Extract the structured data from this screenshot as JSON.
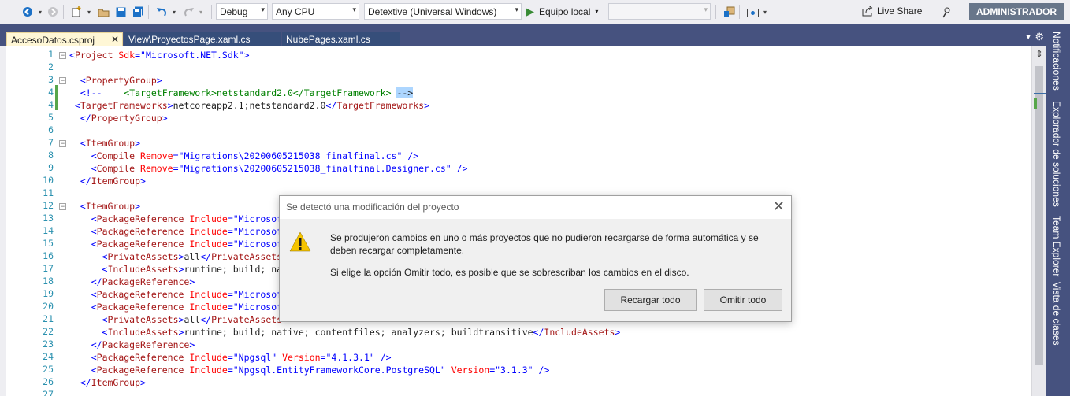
{
  "toolbar": {
    "configuration": "Debug",
    "platform": "Any CPU",
    "startup_project": "Detextive (Universal Windows)",
    "run_target": "Equipo local",
    "live_share": "Live Share",
    "user": "ADMINISTRADOR"
  },
  "tabs": [
    {
      "label": "AccesoDatos.csproj",
      "active": true
    },
    {
      "label": "View\\ProyectosPage.xaml.cs",
      "active": false
    },
    {
      "label": "NubePages.xaml.cs",
      "active": false
    }
  ],
  "side_panels": [
    "Notificaciones",
    "Explorador de soluciones",
    "Team Explorer",
    "Vista de clases"
  ],
  "code": {
    "line_numbers": [
      "1",
      "2",
      "3",
      "4",
      "4",
      "5",
      "6",
      "7",
      "8",
      "9",
      "10",
      "11",
      "12",
      "13",
      "14",
      "15",
      "16",
      "17",
      "18",
      "19",
      "20",
      "21",
      "22",
      "23",
      "24",
      "25",
      "26",
      "27",
      "28"
    ],
    "lines": [
      [
        {
          "c": "p",
          "t": "<"
        },
        {
          "c": "t",
          "t": "Project"
        },
        {
          "c": "a",
          "t": " Sdk"
        },
        {
          "c": "p",
          "t": "=\""
        },
        {
          "c": "v",
          "t": "Microsoft.NET.Sdk"
        },
        {
          "c": "p",
          "t": "\">"
        }
      ],
      [],
      [
        {
          "c": "k",
          "t": "  "
        },
        {
          "c": "p",
          "t": "<"
        },
        {
          "c": "t",
          "t": "PropertyGroup"
        },
        {
          "c": "p",
          "t": ">"
        }
      ],
      [
        {
          "c": "k",
          "t": "  "
        },
        {
          "c": "p",
          "t": "<!--"
        },
        {
          "c": "c",
          "t": "    <TargetFramework>netstandard2.0</TargetFramework> "
        },
        {
          "c": "sel",
          "t": "-->"
        }
      ],
      [
        {
          "c": "k",
          "t": " "
        },
        {
          "c": "p",
          "t": "<"
        },
        {
          "c": "t",
          "t": "TargetFrameworks"
        },
        {
          "c": "p",
          "t": ">"
        },
        {
          "c": "k",
          "t": "netcoreapp2.1;netstandard2.0"
        },
        {
          "c": "p",
          "t": "</"
        },
        {
          "c": "t",
          "t": "TargetFrameworks"
        },
        {
          "c": "p",
          "t": ">"
        }
      ],
      [
        {
          "c": "k",
          "t": "  "
        },
        {
          "c": "p",
          "t": "</"
        },
        {
          "c": "t",
          "t": "PropertyGroup"
        },
        {
          "c": "p",
          "t": ">"
        }
      ],
      [],
      [
        {
          "c": "k",
          "t": "  "
        },
        {
          "c": "p",
          "t": "<"
        },
        {
          "c": "t",
          "t": "ItemGroup"
        },
        {
          "c": "p",
          "t": ">"
        }
      ],
      [
        {
          "c": "k",
          "t": "    "
        },
        {
          "c": "p",
          "t": "<"
        },
        {
          "c": "t",
          "t": "Compile"
        },
        {
          "c": "a",
          "t": " Remove"
        },
        {
          "c": "p",
          "t": "=\""
        },
        {
          "c": "v",
          "t": "Migrations\\20200605215038_finalfinal.cs"
        },
        {
          "c": "p",
          "t": "\" />"
        }
      ],
      [
        {
          "c": "k",
          "t": "    "
        },
        {
          "c": "p",
          "t": "<"
        },
        {
          "c": "t",
          "t": "Compile"
        },
        {
          "c": "a",
          "t": " Remove"
        },
        {
          "c": "p",
          "t": "=\""
        },
        {
          "c": "v",
          "t": "Migrations\\20200605215038_finalfinal.Designer.cs"
        },
        {
          "c": "p",
          "t": "\" />"
        }
      ],
      [
        {
          "c": "k",
          "t": "  "
        },
        {
          "c": "p",
          "t": "</"
        },
        {
          "c": "t",
          "t": "ItemGroup"
        },
        {
          "c": "p",
          "t": ">"
        }
      ],
      [],
      [
        {
          "c": "k",
          "t": "  "
        },
        {
          "c": "p",
          "t": "<"
        },
        {
          "c": "t",
          "t": "ItemGroup"
        },
        {
          "c": "p",
          "t": ">"
        }
      ],
      [
        {
          "c": "k",
          "t": "    "
        },
        {
          "c": "p",
          "t": "<"
        },
        {
          "c": "t",
          "t": "PackageReference"
        },
        {
          "c": "a",
          "t": " Include"
        },
        {
          "c": "p",
          "t": "=\""
        },
        {
          "c": "v",
          "t": "Microsof"
        }
      ],
      [
        {
          "c": "k",
          "t": "    "
        },
        {
          "c": "p",
          "t": "<"
        },
        {
          "c": "t",
          "t": "PackageReference"
        },
        {
          "c": "a",
          "t": " Include"
        },
        {
          "c": "p",
          "t": "=\""
        },
        {
          "c": "v",
          "t": "Microsof"
        }
      ],
      [
        {
          "c": "k",
          "t": "    "
        },
        {
          "c": "p",
          "t": "<"
        },
        {
          "c": "t",
          "t": "PackageReference"
        },
        {
          "c": "a",
          "t": " Include"
        },
        {
          "c": "p",
          "t": "=\""
        },
        {
          "c": "v",
          "t": "Microsof"
        }
      ],
      [
        {
          "c": "k",
          "t": "      "
        },
        {
          "c": "p",
          "t": "<"
        },
        {
          "c": "t",
          "t": "PrivateAssets"
        },
        {
          "c": "p",
          "t": ">"
        },
        {
          "c": "k",
          "t": "all"
        },
        {
          "c": "p",
          "t": "</"
        },
        {
          "c": "t",
          "t": "PrivateAssets"
        }
      ],
      [
        {
          "c": "k",
          "t": "      "
        },
        {
          "c": "p",
          "t": "<"
        },
        {
          "c": "t",
          "t": "IncludeAssets"
        },
        {
          "c": "p",
          "t": ">"
        },
        {
          "c": "k",
          "t": "runtime; build; nat"
        }
      ],
      [
        {
          "c": "k",
          "t": "    "
        },
        {
          "c": "p",
          "t": "</"
        },
        {
          "c": "t",
          "t": "PackageReference"
        },
        {
          "c": "p",
          "t": ">"
        }
      ],
      [
        {
          "c": "k",
          "t": "    "
        },
        {
          "c": "p",
          "t": "<"
        },
        {
          "c": "t",
          "t": "PackageReference"
        },
        {
          "c": "a",
          "t": " Include"
        },
        {
          "c": "p",
          "t": "=\""
        },
        {
          "c": "v",
          "t": "Microsof"
        }
      ],
      [
        {
          "c": "k",
          "t": "    "
        },
        {
          "c": "p",
          "t": "<"
        },
        {
          "c": "t",
          "t": "PackageReference"
        },
        {
          "c": "a",
          "t": " Include"
        },
        {
          "c": "p",
          "t": "=\""
        },
        {
          "c": "v",
          "t": "Microsof"
        }
      ],
      [
        {
          "c": "k",
          "t": "      "
        },
        {
          "c": "p",
          "t": "<"
        },
        {
          "c": "t",
          "t": "PrivateAssets"
        },
        {
          "c": "p",
          "t": ">"
        },
        {
          "c": "k",
          "t": "all"
        },
        {
          "c": "p",
          "t": "</"
        },
        {
          "c": "t",
          "t": "PrivateAssets"
        }
      ],
      [
        {
          "c": "k",
          "t": "      "
        },
        {
          "c": "p",
          "t": "<"
        },
        {
          "c": "t",
          "t": "IncludeAssets"
        },
        {
          "c": "p",
          "t": ">"
        },
        {
          "c": "k",
          "t": "runtime; build; native; contentfiles; analyzers; buildtransitive"
        },
        {
          "c": "p",
          "t": "</"
        },
        {
          "c": "t",
          "t": "IncludeAssets"
        },
        {
          "c": "p",
          "t": ">"
        }
      ],
      [
        {
          "c": "k",
          "t": "    "
        },
        {
          "c": "p",
          "t": "</"
        },
        {
          "c": "t",
          "t": "PackageReference"
        },
        {
          "c": "p",
          "t": ">"
        }
      ],
      [
        {
          "c": "k",
          "t": "    "
        },
        {
          "c": "p",
          "t": "<"
        },
        {
          "c": "t",
          "t": "PackageReference"
        },
        {
          "c": "a",
          "t": " Include"
        },
        {
          "c": "p",
          "t": "=\""
        },
        {
          "c": "v",
          "t": "Npgsql"
        },
        {
          "c": "p",
          "t": "\""
        },
        {
          "c": "a",
          "t": " Version"
        },
        {
          "c": "p",
          "t": "=\""
        },
        {
          "c": "v",
          "t": "4.1.3.1"
        },
        {
          "c": "p",
          "t": "\" />"
        }
      ],
      [
        {
          "c": "k",
          "t": "    "
        },
        {
          "c": "p",
          "t": "<"
        },
        {
          "c": "t",
          "t": "PackageReference"
        },
        {
          "c": "a",
          "t": " Include"
        },
        {
          "c": "p",
          "t": "=\""
        },
        {
          "c": "v",
          "t": "Npgsql.EntityFrameworkCore.PostgreSQL"
        },
        {
          "c": "p",
          "t": "\""
        },
        {
          "c": "a",
          "t": " Version"
        },
        {
          "c": "p",
          "t": "=\""
        },
        {
          "c": "v",
          "t": "3.1.3"
        },
        {
          "c": "p",
          "t": "\" />"
        }
      ],
      [
        {
          "c": "k",
          "t": "  "
        },
        {
          "c": "p",
          "t": "</"
        },
        {
          "c": "t",
          "t": "ItemGroup"
        },
        {
          "c": "p",
          "t": ">"
        }
      ],
      []
    ]
  },
  "dialog": {
    "title": "Se detectó una modificación del proyecto",
    "message": "Se produjeron cambios en uno o más proyectos que no pudieron recargarse de forma automática y se deben recargar completamente.",
    "message2": "Si elige la opción Omitir todo, es posible que se sobrescriban los cambios en el disco.",
    "reload_button": "Recargar todo",
    "ignore_button": "Omitir todo"
  }
}
